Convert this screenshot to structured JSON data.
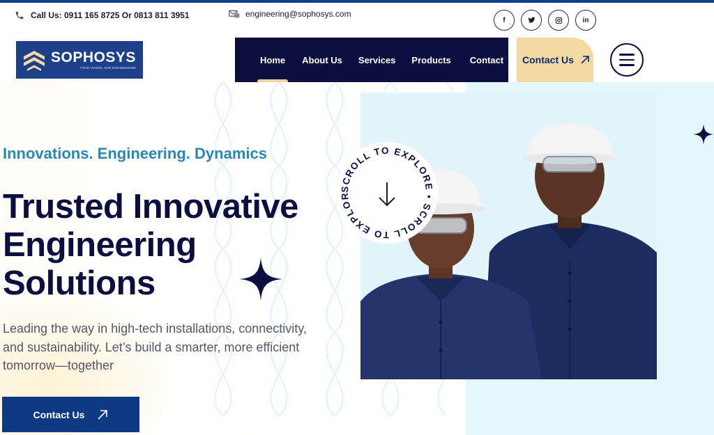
{
  "topbar": {
    "phone_text": "Call Us: 0911 165 8725 Or 0813 811 3951",
    "email_text": "engineering@sophosys.com",
    "socials": [
      {
        "icon": "facebook-icon",
        "glyph": "f"
      },
      {
        "icon": "twitter-icon",
        "glyph": "🐦"
      },
      {
        "icon": "instagram-icon",
        "glyph": "◎"
      },
      {
        "icon": "linkedin-icon",
        "glyph": "in"
      }
    ]
  },
  "logo": {
    "name": "SOPHOSYS",
    "tagline": "YOUR VISION, OUR ENGINEERING"
  },
  "nav": {
    "items": [
      {
        "label": "Home",
        "active": true
      },
      {
        "label": "About Us",
        "active": false
      },
      {
        "label": "Services",
        "active": false
      },
      {
        "label": "Products",
        "active": false
      },
      {
        "label": "Contact",
        "active": false
      }
    ],
    "cta_label": "Contact Us"
  },
  "hero": {
    "tagline": "Innovations. Engineering. Dynamics",
    "headline": "Trusted Innovative Engineering Solutions",
    "subtext": "Leading the way in high-tech installations, connectivity, and sustainability. Let’s build a smarter, more efficient tomorrow—together",
    "cta_label": "Contact Us",
    "scroll_text": "SCROLL TO EXPLORE • SCROLL TO EXPLORE •"
  },
  "colors": {
    "navy": "#0b0f40",
    "brand_blue": "#1e3f8a",
    "accent_gold": "#f3daa5",
    "tagline_blue": "#2787b5",
    "hero_light_blue": "#e6f6fd"
  }
}
